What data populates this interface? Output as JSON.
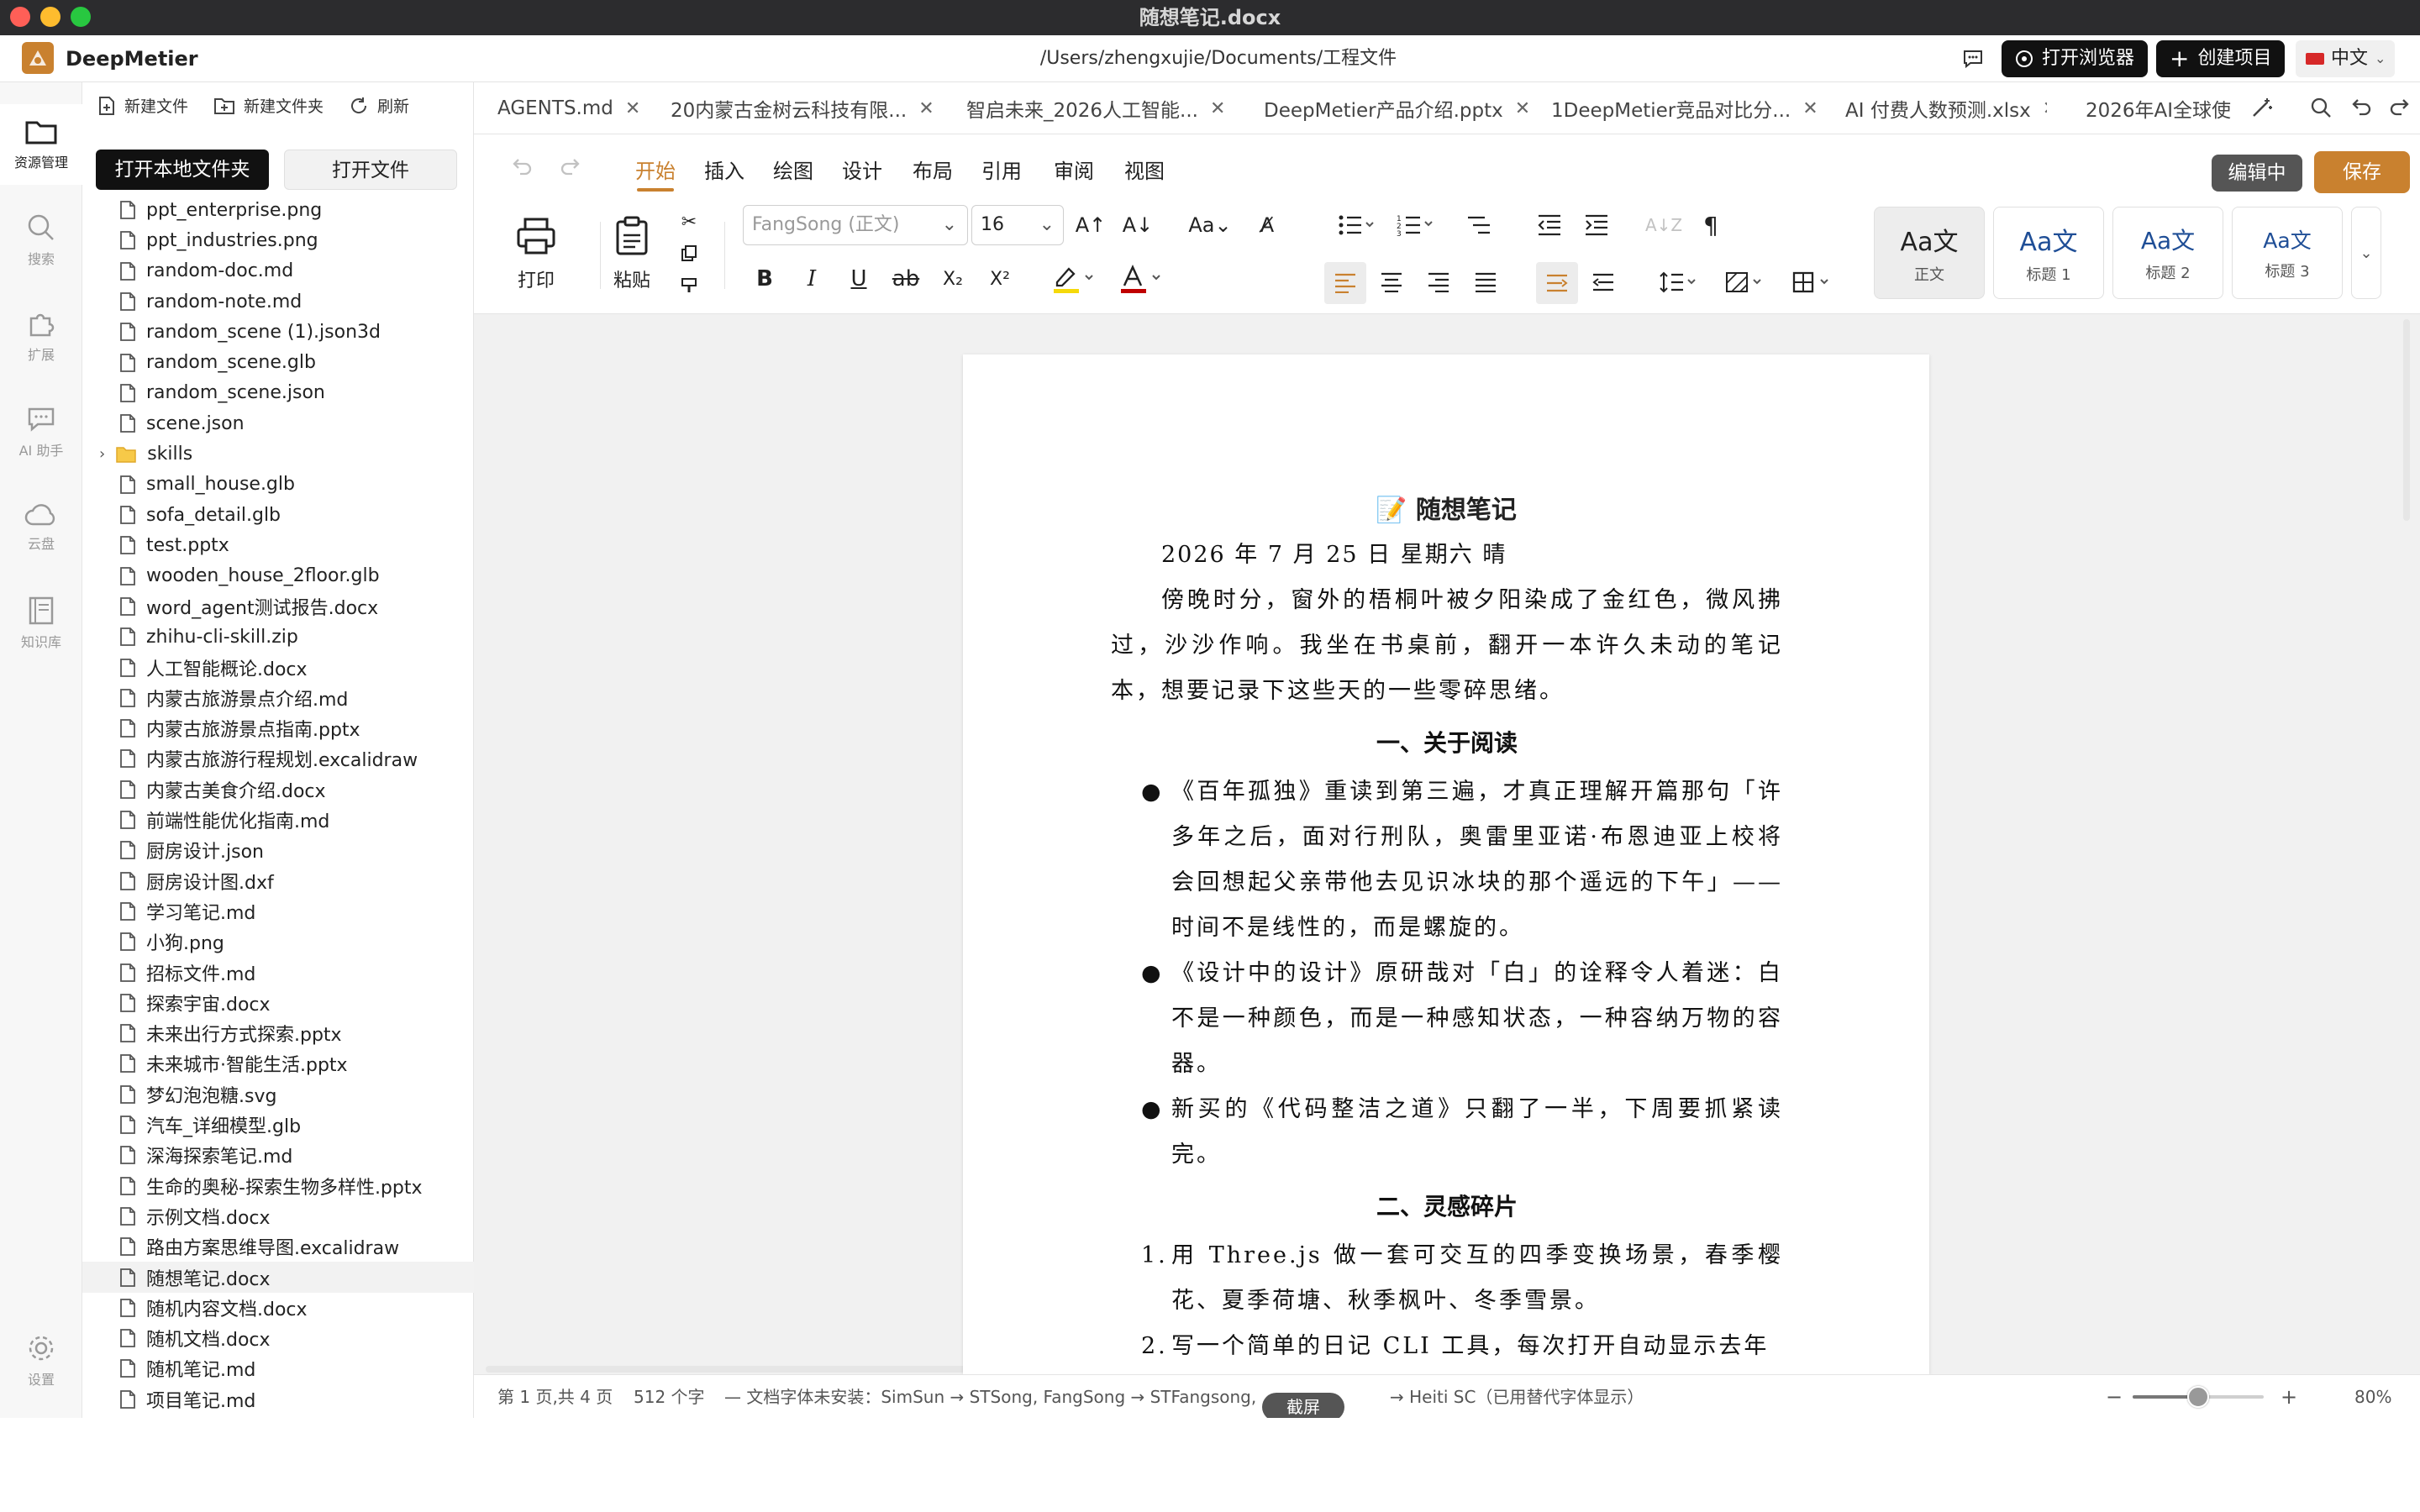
{
  "window": {
    "title": "随想笔记.docx"
  },
  "header": {
    "brand": "DeepMetier",
    "path": "/Users/zhengxujie/Documents/工程文件",
    "open_browser": "打开浏览器",
    "create_project": "创建项目",
    "language": "中文"
  },
  "rail": {
    "items": [
      {
        "label": "资源管理"
      },
      {
        "label": "搜索"
      },
      {
        "label": "扩展"
      },
      {
        "label": "AI 助手"
      },
      {
        "label": "云盘"
      },
      {
        "label": "知识库"
      }
    ],
    "settings": "设置"
  },
  "file_panel": {
    "actions": {
      "new_file": "新建文件",
      "new_folder": "新建文件夹",
      "refresh": "刷新"
    },
    "open_local_folder": "打开本地文件夹",
    "open_file": "打开文件",
    "files": [
      "ppt_enterprise.png",
      "ppt_industries.png",
      "random-doc.md",
      "random-note.md",
      "random_scene (1).json3d",
      "random_scene.glb",
      "random_scene.json",
      "scene.json",
      "skills",
      "small_house.glb",
      "sofa_detail.glb",
      "test.pptx",
      "wooden_house_2floor.glb",
      "word_agent测试报告.docx",
      "zhihu-cli-skill.zip",
      "人工智能概论.docx",
      "内蒙古旅游景点介绍.md",
      "内蒙古旅游景点指南.pptx",
      "内蒙古旅游行程规划.excalidraw",
      "内蒙古美食介绍.docx",
      "前端性能优化指南.md",
      "厨房设计.json",
      "厨房设计图.dxf",
      "学习笔记.md",
      "小狗.png",
      "招标文件.md",
      "探索宇宙.docx",
      "未来出行方式探索.pptx",
      "未来城市·智能生活.pptx",
      "梦幻泡泡糖.svg",
      "汽车_详细模型.glb",
      "深海探索笔记.md",
      "生命的奥秘-探索生物多样性.pptx",
      "示例文档.docx",
      "路由方案思维导图.excalidraw",
      "随想笔记.docx",
      "随机内容文档.docx",
      "随机文档.docx",
      "随机笔记.md",
      "项目笔记.md"
    ]
  },
  "tabs": [
    {
      "label": "AGENTS.md"
    },
    {
      "label": "20内蒙古金树云科技有限..."
    },
    {
      "label": "智启未来_2026人工智能..."
    },
    {
      "label": "DeepMetier产品介绍.pptx"
    },
    {
      "label": "1DeepMetier竞品对比分..."
    },
    {
      "label": "AI 付费人数预测.xlsx"
    },
    {
      "label": "2026年AI全球使"
    }
  ],
  "ribbon": {
    "tabs": [
      "开始",
      "插入",
      "绘图",
      "设计",
      "布局",
      "引用",
      "审阅",
      "视图"
    ],
    "editing": "编辑中",
    "save": "保存",
    "print": "打印",
    "paste": "粘贴",
    "font": "FangSong (正文)",
    "size": "16",
    "styles": [
      {
        "preview": "Aa文",
        "name": "正文"
      },
      {
        "preview": "Aa文",
        "name": "标题 1"
      },
      {
        "preview": "Aa文",
        "name": "标题 2"
      },
      {
        "preview": "Aa文",
        "name": "标题 3"
      }
    ],
    "colors": {
      "highlight": "#f5d90a",
      "font_color": "#c00000",
      "accent": "#c9812f"
    }
  },
  "document": {
    "title": "📝 随想笔记",
    "date": "2026 年 7 月 25 日  星期六  晴",
    "intro": "傍晚时分，窗外的梧桐叶被夕阳染成了金红色，微风拂过，沙沙作响。我坐在书桌前，翻开一本许久未动的笔记本，想要记录下这些天的一些零碎思绪。",
    "section1": {
      "heading": "一、关于阅读",
      "bullets": [
        "《百年孤独》重读到第三遍，才真正理解开篇那句「许多年之后，面对行刑队，奥雷里亚诺·布恩迪亚上校将会回想起父亲带他去见识冰块的那个遥远的下午」——时间不是线性的，而是螺旋的。",
        "《设计中的设计》原研哉对「白」的诠释令人着迷：白不是一种颜色，而是一种感知状态，一种容纳万物的容器。",
        "新买的《代码整洁之道》只翻了一半，下周要抓紧读完。"
      ]
    },
    "section2": {
      "heading": "二、灵感碎片",
      "items": [
        {
          "num": "1.",
          "text": "用 Three.js 做一套可交互的四季变换场景，春季樱花、夏季荷塘、秋季枫叶、冬季雪景。"
        },
        {
          "num": "2.",
          "text": "写一个简单的日记 CLI 工具，每次打开自动显示去年"
        }
      ]
    }
  },
  "status": {
    "page": "第 1 页,共 4 页",
    "words": "512 个字",
    "font_notice_a": "— 文档字体未安装：SimSun → STSong, FangSong → STFangsong,",
    "font_notice_b": "→ Heiti SC（已用替代字体显示）",
    "screenshot": "截屏",
    "minus": "−",
    "plus": "+",
    "zoom_level": 0.5,
    "zoom": "80%"
  }
}
